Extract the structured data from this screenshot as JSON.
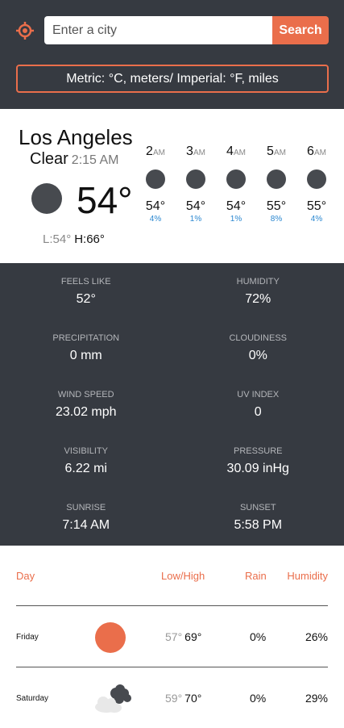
{
  "header": {
    "search_placeholder": "Enter a city",
    "search_label": "Search",
    "units_label": "Metric: °C, meters/ Imperial: °F, miles",
    "accent_color": "#ea6e4b",
    "location_icon": "crosshair-icon"
  },
  "current": {
    "city": "Los Angeles",
    "condition": "Clear",
    "time": "2:15 AM",
    "temp": "54°",
    "low": "L:54°",
    "high": "H:66°",
    "icon": "moon-icon"
  },
  "hourly": [
    {
      "hour": "2",
      "ampm": "AM",
      "temp": "54°",
      "precip": "4%",
      "icon": "moon-icon"
    },
    {
      "hour": "3",
      "ampm": "AM",
      "temp": "54°",
      "precip": "1%",
      "icon": "moon-icon"
    },
    {
      "hour": "4",
      "ampm": "AM",
      "temp": "54°",
      "precip": "1%",
      "icon": "moon-icon"
    },
    {
      "hour": "5",
      "ampm": "AM",
      "temp": "55°",
      "precip": "8%",
      "icon": "moon-icon"
    },
    {
      "hour": "6",
      "ampm": "AM",
      "temp": "55°",
      "precip": "4%",
      "icon": "moon-icon"
    }
  ],
  "details": [
    {
      "label": "FEELS LIKE",
      "value": "52°"
    },
    {
      "label": "HUMIDITY",
      "value": "72%"
    },
    {
      "label": "PRECIPITATION",
      "value": "0 mm"
    },
    {
      "label": "CLOUDINESS",
      "value": "0%"
    },
    {
      "label": "WIND SPEED",
      "value": "23.02 mph"
    },
    {
      "label": "UV INDEX",
      "value": "0"
    },
    {
      "label": "VISIBILITY",
      "value": "6.22 mi"
    },
    {
      "label": "PRESSURE",
      "value": "30.09 inHg"
    },
    {
      "label": "SUNRISE",
      "value": "7:14 AM"
    },
    {
      "label": "SUNSET",
      "value": "5:58 PM"
    }
  ],
  "forecast": {
    "headers": {
      "day": "Day",
      "lowhigh": "Low/High",
      "rain": "Rain",
      "humidity": "Humidity"
    },
    "rows": [
      {
        "day": "Friday",
        "low": "57°",
        "high": "69°",
        "rain": "0%",
        "humidity": "26%",
        "icon": "sun-icon"
      },
      {
        "day": "Saturday",
        "low": "59°",
        "high": "70°",
        "rain": "0%",
        "humidity": "29%",
        "icon": "cloudy-icon"
      }
    ]
  }
}
